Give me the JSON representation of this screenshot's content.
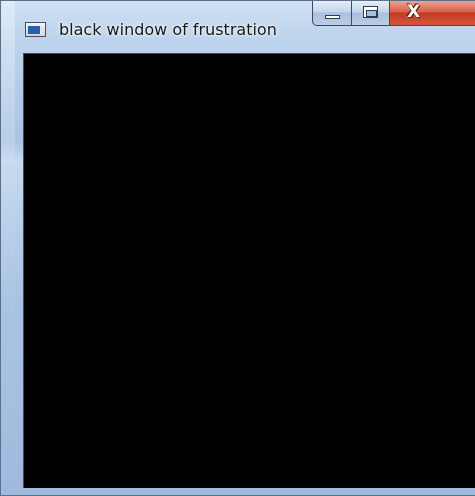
{
  "window": {
    "title": "black window of frustration",
    "icon": "application-window-icon",
    "controls": {
      "minimize": "minimize-icon",
      "maximize": "maximize-icon",
      "close_label": "X"
    },
    "client_background": "#000000"
  }
}
